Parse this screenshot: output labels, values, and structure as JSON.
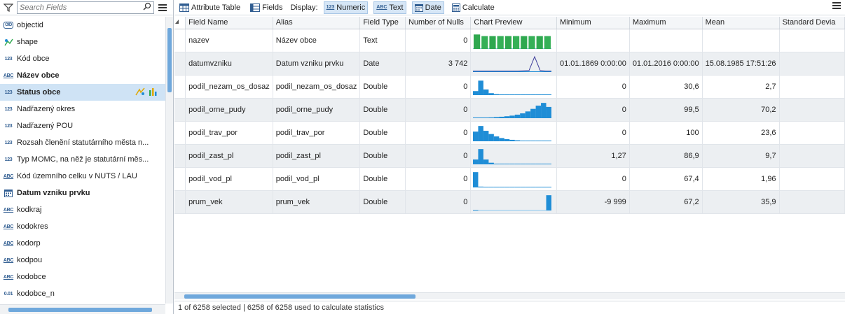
{
  "left": {
    "search_placeholder": "Search Fields",
    "fields": [
      {
        "icon": "OID",
        "type": "oid",
        "label": "objectid",
        "bold": false
      },
      {
        "icon": "SHP",
        "type": "shape",
        "label": "shape",
        "bold": false
      },
      {
        "icon": "123",
        "type": "num",
        "label": "Kód obce",
        "bold": false
      },
      {
        "icon": "ABC",
        "type": "abc",
        "label": "Název obce",
        "bold": true
      },
      {
        "icon": "123",
        "type": "num",
        "label": "Status obce",
        "bold": true,
        "selected": true
      },
      {
        "icon": "123",
        "type": "num",
        "label": "Nadřazený okres",
        "bold": false
      },
      {
        "icon": "123",
        "type": "num",
        "label": "Nadřazený POU",
        "bold": false
      },
      {
        "icon": "123",
        "type": "num",
        "label": "Rozsah členění statutárního města n...",
        "bold": false
      },
      {
        "icon": "123",
        "type": "num",
        "label": "Typ MOMC, na něž je statutární měs...",
        "bold": false
      },
      {
        "icon": "ABC",
        "type": "abc",
        "label": "Kód územního celku v NUTS / LAU",
        "bold": false
      },
      {
        "icon": "DATE",
        "type": "date",
        "label": "Datum vzniku prvku",
        "bold": true
      },
      {
        "icon": "ABC",
        "type": "abc",
        "label": "kodkraj",
        "bold": false
      },
      {
        "icon": "ABC",
        "type": "abc",
        "label": "kodokres",
        "bold": false
      },
      {
        "icon": "ABC",
        "type": "abc",
        "label": "kodorp",
        "bold": false
      },
      {
        "icon": "ABC",
        "type": "abc",
        "label": "kodpou",
        "bold": false
      },
      {
        "icon": "ABC",
        "type": "abc",
        "label": "kodobce",
        "bold": false
      },
      {
        "icon": "0.01",
        "type": "num",
        "label": "kodobce_n",
        "bold": false
      }
    ]
  },
  "toolbar": {
    "attribute_table": "Attribute Table",
    "fields": "Fields",
    "display": "Display:",
    "numeric": "Numeric",
    "text": "Text",
    "date": "Date",
    "calculate": "Calculate",
    "numeric_glyph": "123",
    "text_glyph": "ABC"
  },
  "grid": {
    "columns": [
      "Field Name",
      "Alias",
      "Field Type",
      "Number of Nulls",
      "Chart Preview",
      "Minimum",
      "Maximum",
      "Mean",
      "Standard Devia"
    ],
    "rows": [
      {
        "name": "nazev",
        "alias": "Název obce",
        "type": "Text",
        "nulls": "0",
        "min": "",
        "max": "",
        "mean": "",
        "chart": {
          "kind": "cat",
          "bars": [
            0.9,
            0.8,
            0.8,
            0.8,
            0.8,
            0.8,
            0.8,
            0.8,
            0.8,
            0.8
          ]
        }
      },
      {
        "name": "datumvzniku",
        "alias": "Datum vzniku prvku",
        "type": "Date",
        "nulls": "3 742",
        "min": "01.01.1869 0:00:00",
        "max": "01.01.2016 0:00:00",
        "mean": "15.08.1985 17:51:26",
        "chart": {
          "kind": "line",
          "points": [
            0.02,
            0.02,
            0.02,
            0.02,
            0.02,
            0.02,
            0.02,
            0.02,
            0.02,
            0.03,
            0.05,
            0.95,
            0.05,
            0.02,
            0.02
          ]
        }
      },
      {
        "name": "podil_nezam_os_dosaz",
        "alias": "podil_nezam_os_dosaz",
        "type": "Double",
        "nulls": "0",
        "min": "0",
        "max": "30,6",
        "mean": "2,7",
        "chart": {
          "kind": "hist",
          "bars": [
            0.25,
            0.9,
            0.35,
            0.12,
            0.06,
            0.03,
            0.02,
            0.01,
            0.01,
            0.01,
            0.01,
            0.01,
            0.01,
            0.01,
            0.01
          ]
        }
      },
      {
        "name": "podil_orne_pudy",
        "alias": "podil_orne_pudy",
        "type": "Double",
        "nulls": "0",
        "min": "0",
        "max": "99,5",
        "mean": "70,2",
        "chart": {
          "kind": "hist",
          "bars": [
            0.02,
            0.03,
            0.04,
            0.05,
            0.07,
            0.09,
            0.12,
            0.16,
            0.22,
            0.3,
            0.42,
            0.58,
            0.78,
            0.95,
            0.7
          ]
        }
      },
      {
        "name": "podil_trav_por",
        "alias": "podil_trav_por",
        "type": "Double",
        "nulls": "0",
        "min": "0",
        "max": "100",
        "mean": "23,6",
        "chart": {
          "kind": "hist",
          "bars": [
            0.6,
            0.95,
            0.65,
            0.45,
            0.3,
            0.2,
            0.13,
            0.09,
            0.06,
            0.04,
            0.03,
            0.02,
            0.02,
            0.01,
            0.01
          ]
        }
      },
      {
        "name": "podil_zast_pl",
        "alias": "podil_zast_pl",
        "type": "Double",
        "nulls": "0",
        "min": "1,27",
        "max": "86,9",
        "mean": "9,7",
        "chart": {
          "kind": "hist",
          "bars": [
            0.3,
            0.95,
            0.3,
            0.1,
            0.04,
            0.02,
            0.01,
            0.01,
            0.01,
            0.01,
            0.01,
            0.01,
            0.01,
            0.01,
            0.01
          ]
        }
      },
      {
        "name": "podil_vod_pl",
        "alias": "podil_vod_pl",
        "type": "Double",
        "nulls": "0",
        "min": "0",
        "max": "67,4",
        "mean": "1,96",
        "chart": {
          "kind": "hist",
          "bars": [
            0.95,
            0.05,
            0.01,
            0.01,
            0.01,
            0.01,
            0.01,
            0.01,
            0.01,
            0.01,
            0.01,
            0.01,
            0.01,
            0.01,
            0.01
          ]
        }
      },
      {
        "name": "prum_vek",
        "alias": "prum_vek",
        "type": "Double",
        "nulls": "0",
        "min": "-9 999",
        "max": "67,2",
        "mean": "35,9",
        "chart": {
          "kind": "hist",
          "bars": [
            0.01,
            0.0,
            0.0,
            0.0,
            0.0,
            0.0,
            0.0,
            0.0,
            0.0,
            0.0,
            0.0,
            0.0,
            0.0,
            0.0,
            0.95
          ]
        }
      }
    ]
  },
  "status": "1 of 6258 selected | 6258 of 6258 used to calculate statistics",
  "colors": {
    "accent": "#1f8dd6",
    "bar_green": "#2fa84f",
    "selection": "#cfe3f5"
  }
}
